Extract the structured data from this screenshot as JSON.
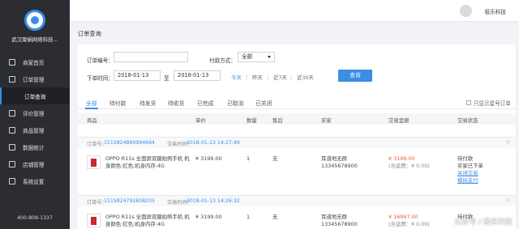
{
  "sidebar": {
    "company": "武汉聚蜗网络科技...",
    "items": [
      {
        "label": "商家首页"
      },
      {
        "label": "订单管理"
      },
      {
        "label": "订单查询"
      },
      {
        "label": "评价管理"
      },
      {
        "label": "商品管理"
      },
      {
        "label": "数据统计"
      },
      {
        "label": "店铺管理"
      },
      {
        "label": "系统设置"
      }
    ],
    "phone": "400-808-1337"
  },
  "topbar": {
    "username": "极乐科技"
  },
  "page": {
    "title": "订单查询"
  },
  "filters": {
    "order_no_label": "订单编号：",
    "order_no_value": "",
    "pay_method_label": "付款方式：",
    "pay_method_value": "全部",
    "time_label": "下单时间：",
    "date_from": "2018-01-13",
    "date_to_label": "至",
    "date_to": "2018-01-13",
    "quick": [
      "今天",
      "昨天",
      "近7天",
      "近30天"
    ],
    "query_button": "查询"
  },
  "tabs": [
    "全部",
    "待付款",
    "待发货",
    "待收货",
    "已完成",
    "已取消",
    "已关闭"
  ],
  "only_starred": "只显示星号订单",
  "columns": [
    "商品",
    "单价",
    "数量",
    "售后",
    "买家",
    "交易金额",
    "交易状态"
  ],
  "orders": [
    {
      "order_no_label": "订单号：",
      "order_no": "1515824869994664",
      "time_label": "交易时间：",
      "time": "2018-01-13 14:27:49",
      "product_line1": "OPPO R11s 全面屏双摄拍照手机 机",
      "product_line2": "身颜色:红色;机身内存:4G",
      "price": "¥ 3199.00",
      "qty": "1",
      "after_sale": "无",
      "buyer_name": "耳道地无群",
      "buyer_phone": "13345678900",
      "amount": "¥ 3199.00",
      "freight": "(含运费：¥ 0.00)",
      "status": [
        "待付款",
        "买家已下单"
      ],
      "actions": [
        "关闭交易",
        "模拟支付"
      ]
    },
    {
      "order_no_label": "订单号：",
      "order_no": "1515824792608205",
      "time_label": "交易时间：",
      "time": "2018-01-13 14:26:32",
      "product_line1": "OPPO R11s 全面屏双摄拍照手机 机",
      "product_line2": "身颜色:红色;机身内存:4G",
      "price": "¥ 3199.00",
      "qty": "1",
      "after_sale": "无",
      "buyer_name": "耳道地无群",
      "buyer_phone": "13345678900",
      "amount": "¥ 16997.00",
      "freight": "(含运费：¥ 0.00)",
      "status": [
        "待付款"
      ],
      "actions": []
    }
  ],
  "watermark": "头条号 / 极乐科技"
}
